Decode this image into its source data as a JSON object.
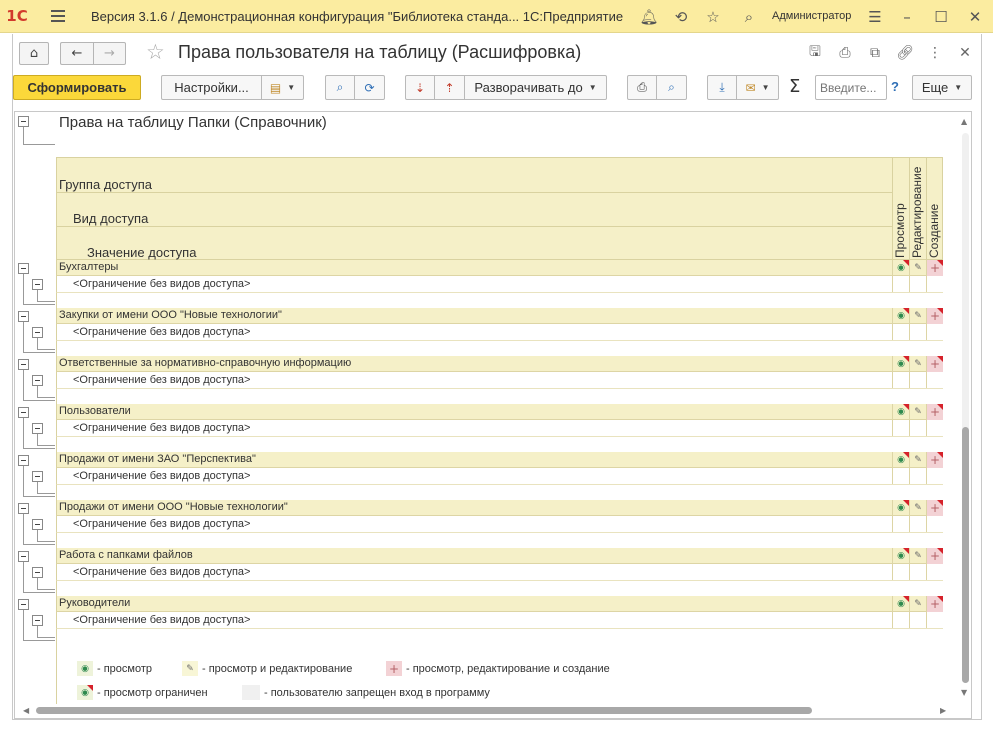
{
  "window": {
    "title": "Версия 3.1.6 / Демонстрационная конфигурация \"Библиотека станда... 1С:Предприятие",
    "user": "Администратор",
    "logo": "1С"
  },
  "form": {
    "title": "Права пользователя на таблицу (Расшифровка)"
  },
  "toolbar": {
    "generate_label": "Сформировать",
    "settings_label": "Настройки...",
    "expand_label": "Разворачивать до",
    "search_placeholder": "Введите...",
    "help_label": "?",
    "more_label": "Еще",
    "sigma_label": "Σ"
  },
  "report": {
    "title": "Права на таблицу Папки (Справочник)",
    "headers": {
      "group": "Группа доступа",
      "kind": "Вид доступа",
      "value": "Значение доступа",
      "col_view": "Просмотр",
      "col_edit": "Редактирование",
      "col_create": "Создание"
    },
    "groups": [
      {
        "name": "Бухгалтеры",
        "sub": "<Ограничение без видов доступа>"
      },
      {
        "name": "Закупки от имени ООО \"Новые технологии\"",
        "sub": "<Ограничение без видов доступа>"
      },
      {
        "name": "Ответственные за нормативно-справочную информацию",
        "sub": "<Ограничение без видов доступа>"
      },
      {
        "name": "Пользователи",
        "sub": "<Ограничение без видов доступа>"
      },
      {
        "name": "Продажи от имени ЗАО \"Перспектива\"",
        "sub": "<Ограничение без видов доступа>"
      },
      {
        "name": "Продажи от имени ООО \"Новые технологии\"",
        "sub": "<Ограничение без видов доступа>"
      },
      {
        "name": "Работа с папками файлов",
        "sub": "<Ограничение без видов доступа>"
      },
      {
        "name": "Руководители",
        "sub": "<Ограничение без видов доступа>"
      }
    ],
    "legend": {
      "view": "- просмотр",
      "view_edit": "- просмотр и редактирование",
      "view_edit_create": "- просмотр, редактирование и создание",
      "view_restricted": "- просмотр ограничен",
      "login_denied": "- пользователю запрещен вход в программу"
    }
  },
  "colors": {
    "title_bar": "#fbeca0",
    "primary_button": "#fbd83a",
    "header_fill": "#f5f0c8",
    "create_cell": "#f3d2d5",
    "restricted_marker": "#d6222b"
  }
}
